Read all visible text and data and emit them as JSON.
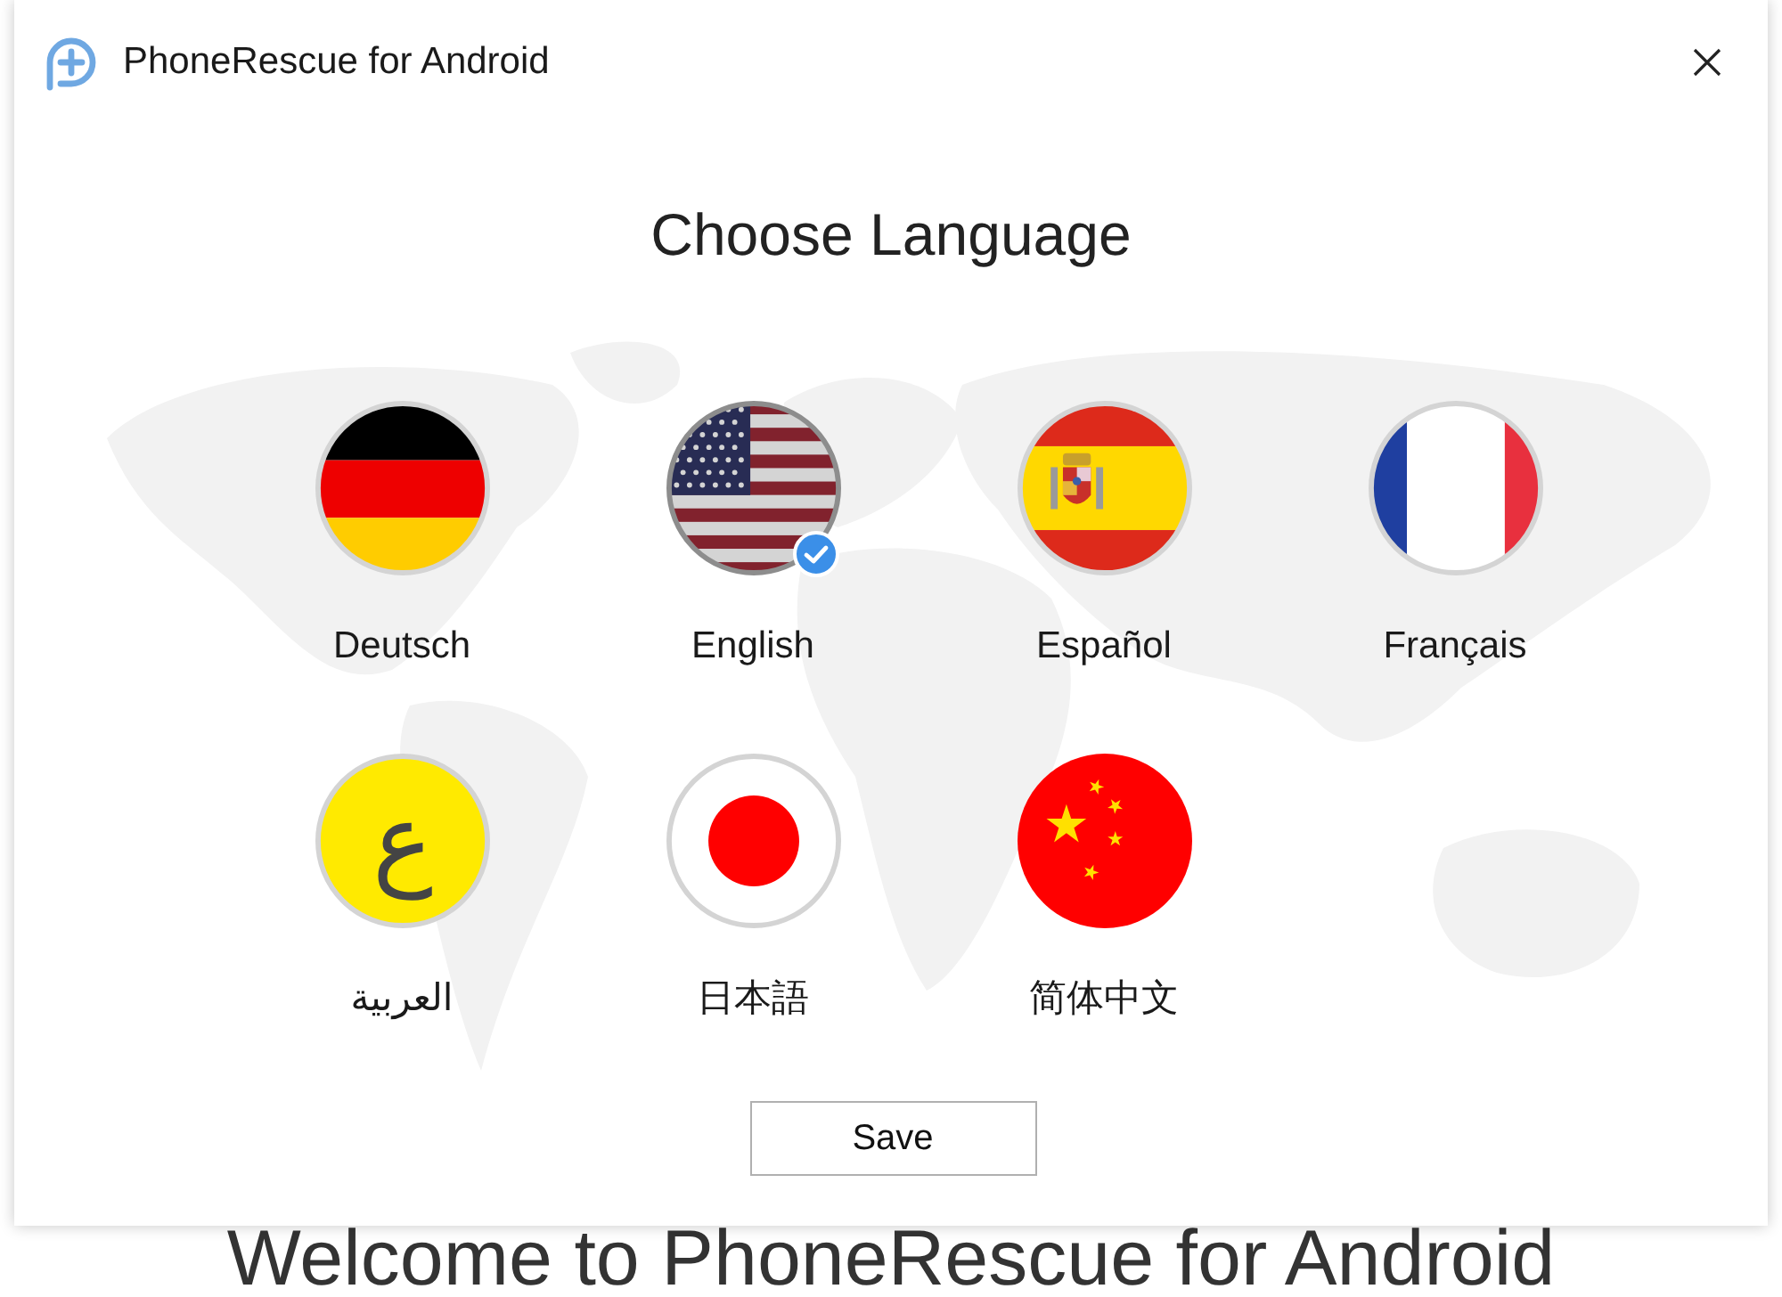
{
  "window": {
    "title": "PhoneRescue for Android"
  },
  "heading": "Choose Language",
  "languages": [
    {
      "label": "Deutsch",
      "kind": "germany",
      "selected": false
    },
    {
      "label": "English",
      "kind": "usa",
      "selected": true
    },
    {
      "label": "Español",
      "kind": "spain",
      "selected": false
    },
    {
      "label": "Français",
      "kind": "france",
      "selected": false
    },
    {
      "label": "العربية",
      "kind": "arabic",
      "glyph": "ع",
      "selected": false
    },
    {
      "label": "日本語",
      "kind": "japan",
      "selected": false
    },
    {
      "label": "简体中文",
      "kind": "china",
      "selected": false
    }
  ],
  "save_button": {
    "label": "Save"
  },
  "background_page": {
    "heading": "Welcome to PhoneRescue for Android"
  }
}
